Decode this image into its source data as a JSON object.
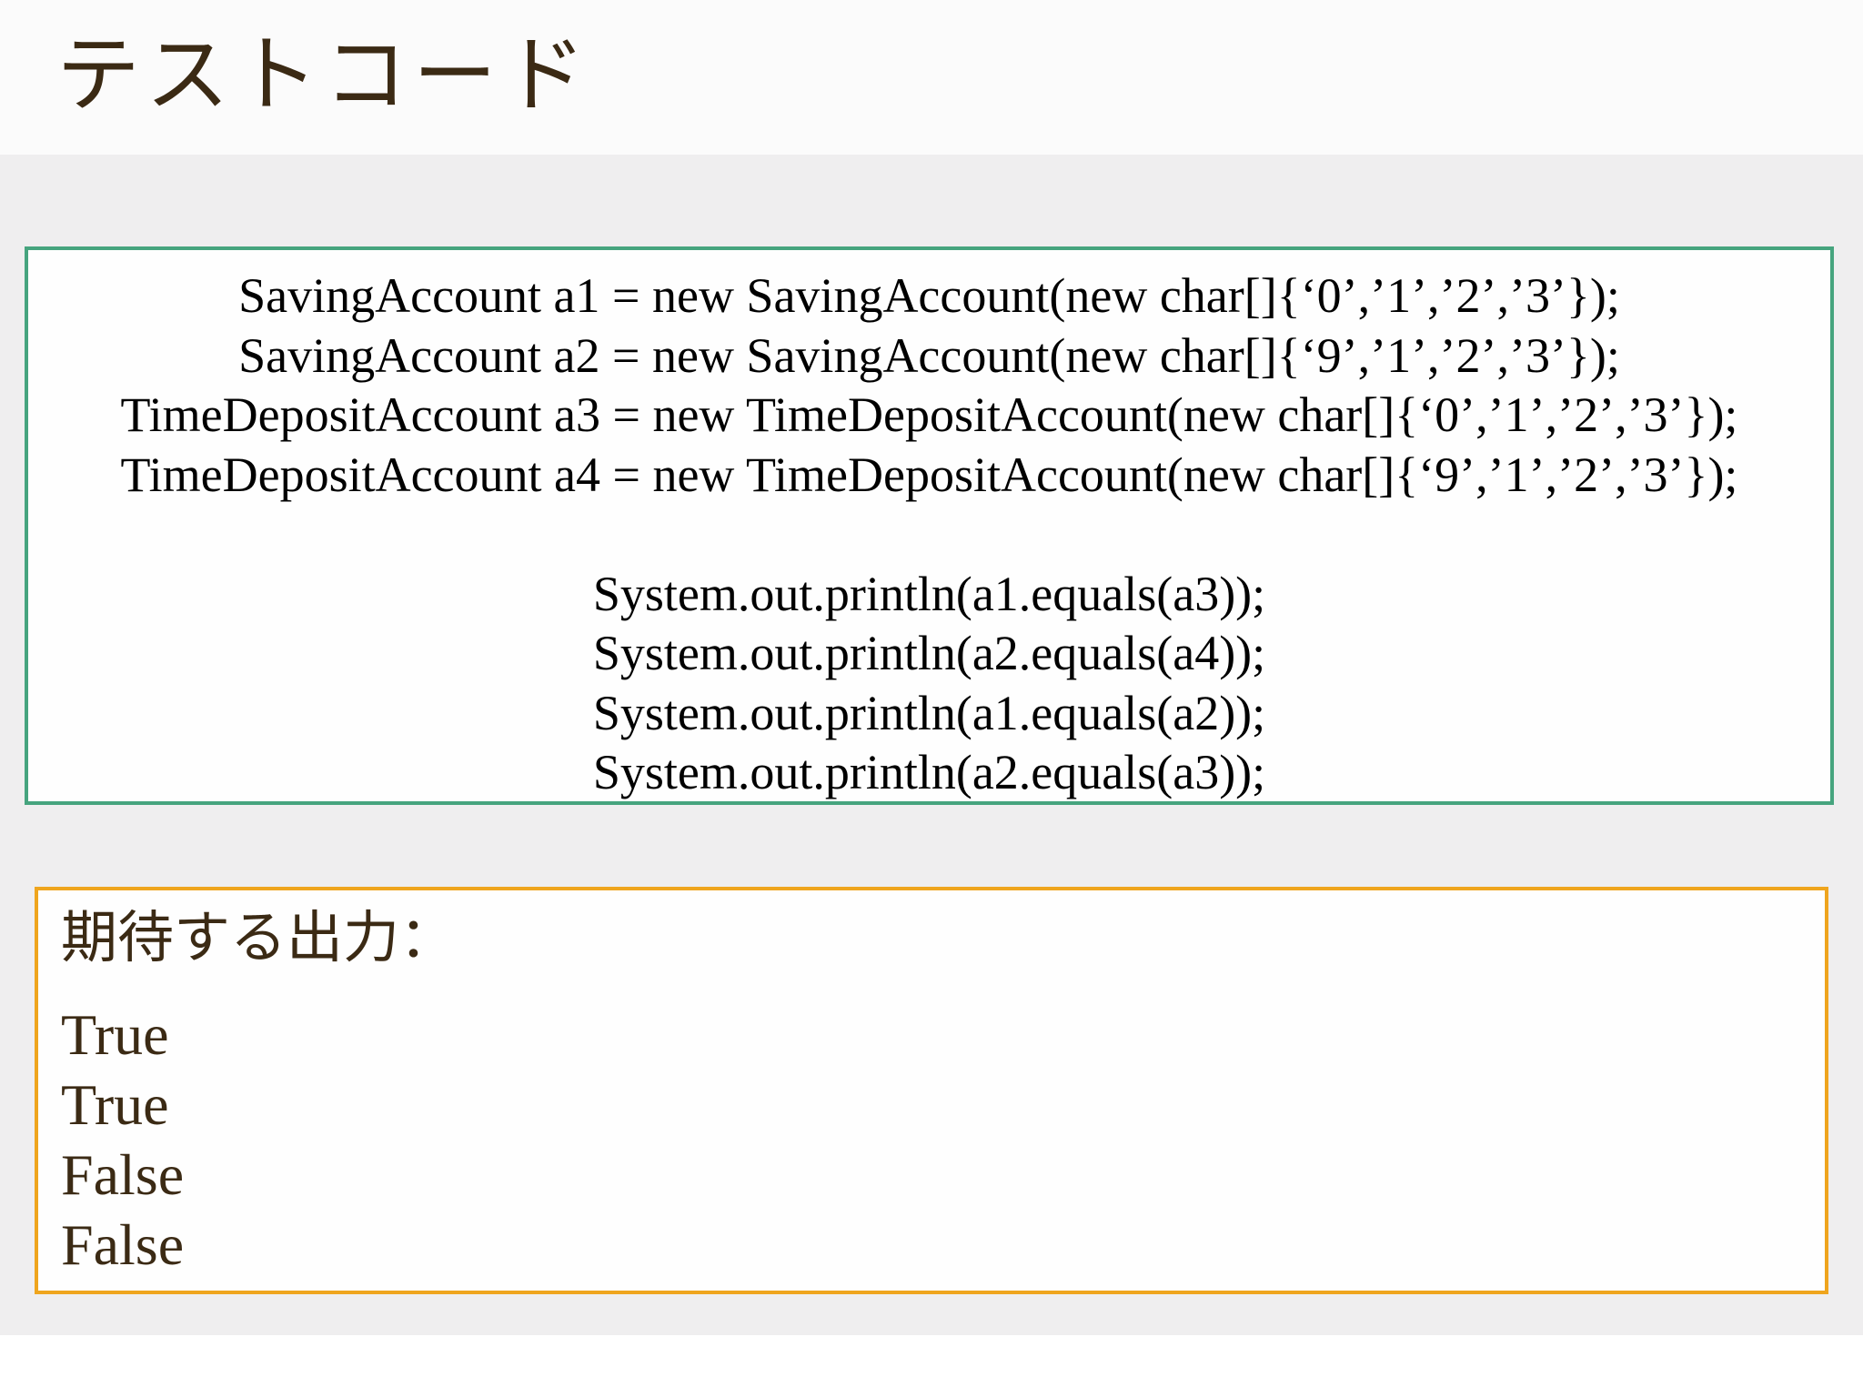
{
  "slide": {
    "title": "テストコード"
  },
  "code": {
    "lines": [
      "SavingAccount a1 = new SavingAccount(new char[]{‘0’,’1’,’2’,’3’});",
      "SavingAccount a2 = new SavingAccount(new char[]{‘9’,’1’,’2’,’3’});",
      "TimeDepositAccount a3 = new TimeDepositAccount(new char[]{‘0’,’1’,’2’,’3’});",
      "TimeDepositAccount a4 = new TimeDepositAccount(new char[]{‘9’,’1’,’2’,’3’});",
      "",
      "System.out.println(a1.equals(a3));",
      "System.out.println(a2.equals(a4));",
      "System.out.println(a1.equals(a2));",
      "System.out.println(a2.equals(a3));"
    ]
  },
  "expected_output": {
    "heading": "期待する出力：",
    "lines": [
      "True",
      "True",
      "False",
      "False"
    ]
  },
  "colors": {
    "code_border": "#46a47e",
    "output_border": "#efa51e",
    "title_text": "#3b2a14"
  }
}
